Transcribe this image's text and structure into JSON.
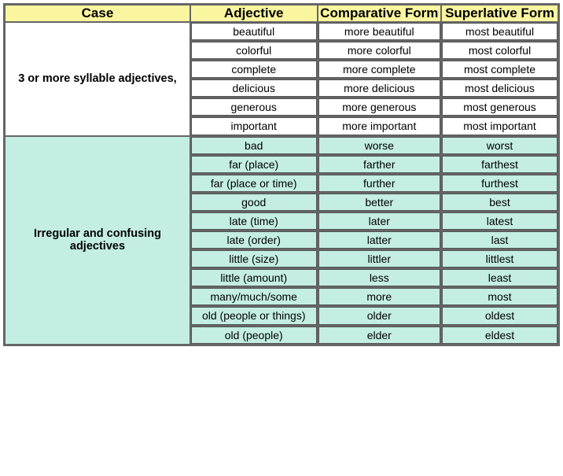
{
  "headers": {
    "case": "Case",
    "adjective": "Adjective",
    "comparative": "Comparative Form",
    "superlative": "Superlative Form"
  },
  "groups": [
    {
      "label": "3 or more syllable adjectives,",
      "theme": "white",
      "rows": [
        {
          "adj": "beautiful",
          "comp": "more beautiful",
          "sup": "most beautiful"
        },
        {
          "adj": "colorful",
          "comp": "more colorful",
          "sup": "most colorful"
        },
        {
          "adj": "complete",
          "comp": "more complete",
          "sup": "most complete"
        },
        {
          "adj": "delicious",
          "comp": "more delicious",
          "sup": "most delicious"
        },
        {
          "adj": "generous",
          "comp": "more generous",
          "sup": "most generous"
        },
        {
          "adj": "important",
          "comp": "more important",
          "sup": "most important"
        }
      ]
    },
    {
      "label": "Irregular and confusing adjectives",
      "theme": "mint",
      "rows": [
        {
          "adj": "bad",
          "comp": "worse",
          "sup": "worst"
        },
        {
          "adj": "far (place)",
          "comp": "farther",
          "sup": "farthest"
        },
        {
          "adj": "far (place or time)",
          "comp": "further",
          "sup": "furthest"
        },
        {
          "adj": "good",
          "comp": "better",
          "sup": "best"
        },
        {
          "adj": "late (time)",
          "comp": "later",
          "sup": "latest"
        },
        {
          "adj": "late (order)",
          "comp": "latter",
          "sup": "last"
        },
        {
          "adj": "little (size)",
          "comp": "littler",
          "sup": "littlest"
        },
        {
          "adj": "little (amount)",
          "comp": "less",
          "sup": "least"
        },
        {
          "adj": "many/much/some",
          "comp": "more",
          "sup": "most"
        },
        {
          "adj": "old (people or things)",
          "comp": "older",
          "sup": "oldest"
        },
        {
          "adj": "old (people)",
          "comp": "elder",
          "sup": "eldest"
        }
      ]
    }
  ]
}
